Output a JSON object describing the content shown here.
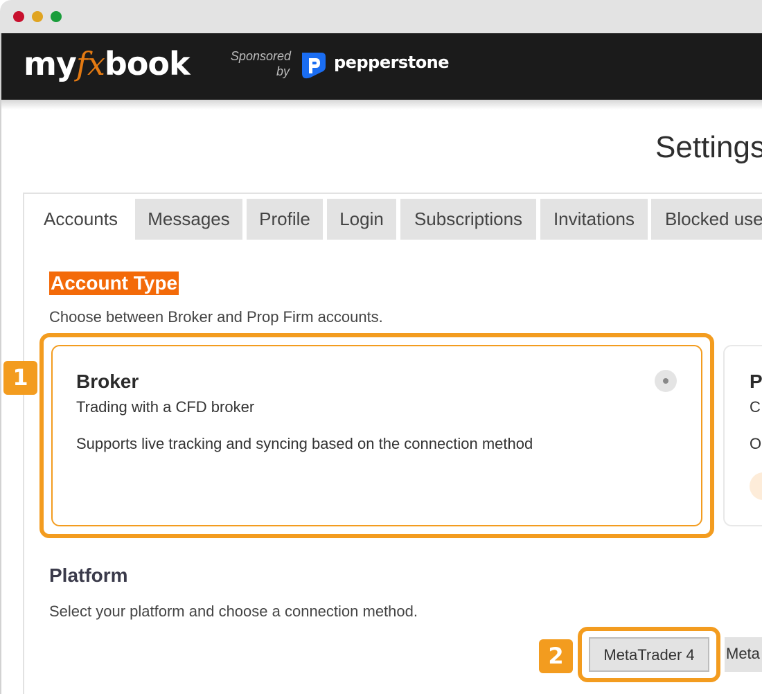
{
  "window": {
    "controls": [
      "close-dot",
      "minimize-dot",
      "maximize-dot"
    ]
  },
  "header": {
    "logo_pre": "my",
    "logo_fx": "fx",
    "logo_post": "book",
    "sponsored_line1": "Sponsored",
    "sponsored_line2": "by",
    "sponsor_name": "pepperstone",
    "sponsor_icon": "pepperstone-logo-icon"
  },
  "page": {
    "title": "Settings"
  },
  "tabs": [
    {
      "label": "Accounts",
      "active": true
    },
    {
      "label": "Messages",
      "active": false
    },
    {
      "label": "Profile",
      "active": false
    },
    {
      "label": "Login",
      "active": false
    },
    {
      "label": "Subscriptions",
      "active": false
    },
    {
      "label": "Invitations",
      "active": false
    },
    {
      "label": "Blocked users",
      "active": false
    }
  ],
  "account_type": {
    "title": "Account Type",
    "description": "Choose between Broker and Prop Firm accounts.",
    "cards": [
      {
        "title": "Broker",
        "subtitle": "Trading with a CFD broker",
        "description": "Supports live tracking and syncing based on the connection method",
        "selected": false
      },
      {
        "title": "P",
        "subtitle": "C",
        "description": "O"
      }
    ]
  },
  "platform": {
    "title": "Platform",
    "description": "Select your platform and choose a connection method.",
    "options": [
      "MetaTrader 4",
      "Meta"
    ]
  },
  "annotations": {
    "badge_1": "1",
    "badge_2": "2",
    "highlight_color": "#f39c1f"
  },
  "colors": {
    "header_bg": "#1b1b1b",
    "accent_orange": "#f36a09",
    "pepperstone_blue": "#1a6df2"
  }
}
